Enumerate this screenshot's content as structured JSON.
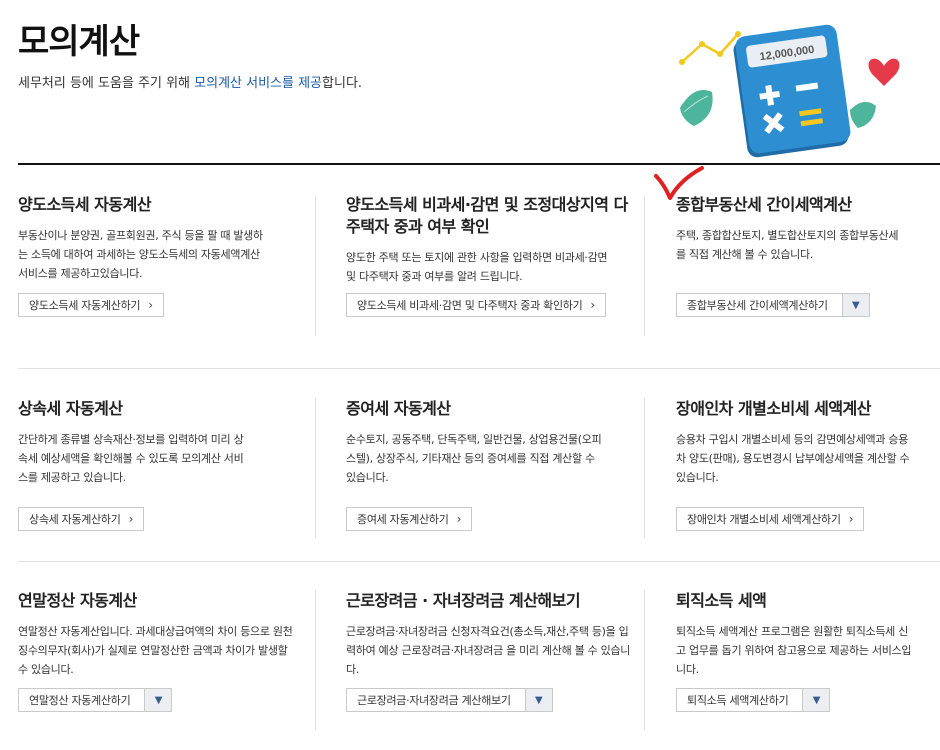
{
  "header": {
    "title": "모의계산",
    "subtitle_prefix": "세무처리 등에 도움을 주기 위해 ",
    "subtitle_highlight": "모의계산 서비스를 제공",
    "subtitle_suffix": "합니다.",
    "illustration_value": "12,000,000"
  },
  "cards": [
    {
      "title": "양도소득세 자동계산",
      "desc": "부동산이나 분양권, 골프회원권, 주식 등을 팔 때 발생하는 소득에 대하여 과세하는 양도소득세의 자동세액계산 서비스를 제공하고있습니다.",
      "button": "양도소득세 자동계산하기"
    },
    {
      "title": "양도소득세 비과세·감면 및 조정대상지역 다주택자 중과 여부 확인",
      "desc": "양도한 주택 또는 토지에 관한 사항을 입력하면 비과세·감면 및 다주택자 중과 여부를 알려 드립니다.",
      "button": "양도소득세 비과세·감면 및 다주택자 중과 확인하기"
    },
    {
      "title": "종합부동산세 간이세액계산",
      "desc": "주택, 종합합산토지, 별도합산토지의 종합부동산세를 직접 계산해 볼 수 있습니다.",
      "button": "종합부동산세 간이세액계산하기"
    },
    {
      "title": "상속세 자동계산",
      "desc": "간단하게 종류별 상속재산·정보를 입력하여 미리 상속세 예상세액을 확인해볼 수 있도록 모의계산 서비스를 제공하고 있습니다.",
      "button": "상속세 자동계산하기"
    },
    {
      "title": "증여세 자동계산",
      "desc": "순수토지, 공동주택, 단독주택, 일반건물, 상업용건물(오피스텔), 상장주식, 기타재산 등의 증여세를 직접 계산할 수 있습니다.",
      "button": "증여세 자동계산하기"
    },
    {
      "title": "장애인차 개별소비세 세액계산",
      "desc": "승용차 구입시 개별소비세 등의 감면예상세액과 승용차 양도(판매), 용도변경시 납부예상세액을 계산할 수 있습니다.",
      "button": "장애인차 개별소비세 세액계산하기"
    },
    {
      "title": "연말정산 자동계산",
      "desc": "연말정산 자동계산입니다. 과세대상급여액의 차이 등으로 원천징수의무자(회사)가 실제로 연말정산한 금액과 차이가 발생할 수 있습니다.",
      "button": "연말정산 자동계산하기"
    },
    {
      "title": "근로장려금 · 자녀장려금 계산해보기",
      "desc": "근로장려금·자녀장려금 신청자격요건(총소득,재산,주택 등)을 입력하여 예상 근로장려금·자녀장려금 을 미리 계산해 볼 수 있습니다.",
      "button": "근로장려금·자녀장려금 계산해보기"
    },
    {
      "title": "퇴직소득 세액",
      "desc": "퇴직소득 세액계산 프로그램은 원활한 퇴직소득세 신고 업무를 돕기 위하여 참고용으로 제공하는 서비스입니다.",
      "button": "퇴직소득 세액계산하기"
    }
  ],
  "colors": {
    "accent": "#1a5aa6",
    "check_mark": "#e02020"
  }
}
